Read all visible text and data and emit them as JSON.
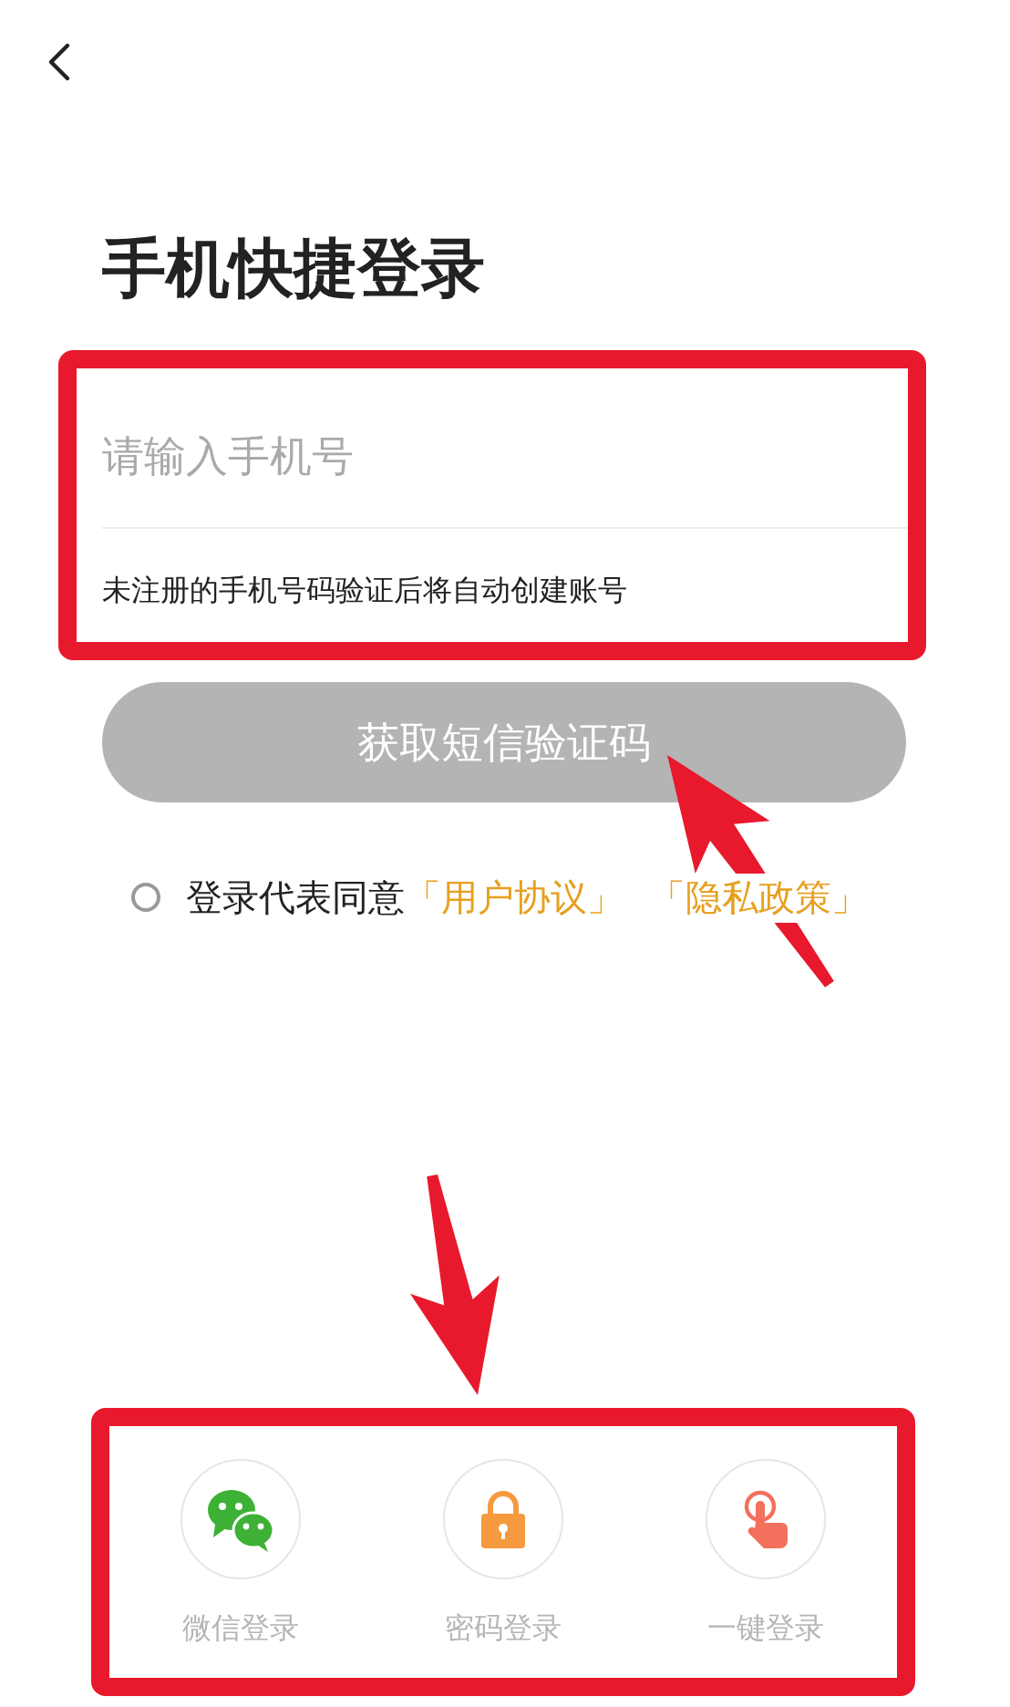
{
  "title": "手机快捷登录",
  "phone_field": {
    "placeholder": "请输入手机号"
  },
  "hint": "未注册的手机号码验证后将自动创建账号",
  "sms_button": {
    "label": "获取短信验证码",
    "disabled": true
  },
  "agreement": {
    "checked": false,
    "prefix": "登录代表同意",
    "links": [
      "「用户协议」",
      "「隐私政策」"
    ]
  },
  "alt_logins": [
    {
      "kind": "wechat",
      "label": "微信登录"
    },
    {
      "kind": "password",
      "label": "密码登录"
    },
    {
      "kind": "onetap",
      "label": "一键登录"
    }
  ]
}
